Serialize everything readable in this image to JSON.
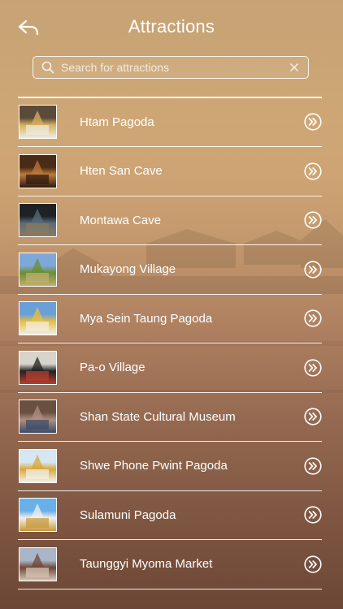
{
  "header": {
    "back_icon": "back-arrow-icon",
    "title": "Attractions"
  },
  "search": {
    "placeholder": "Search for attractions",
    "value": "",
    "icon": "search-icon",
    "clear_icon": "clear-icon"
  },
  "attractions": [
    {
      "name": "Htam Pagoda",
      "thumb_colors": [
        "#5a4a3a",
        "#d7b060",
        "#f0ece0"
      ]
    },
    {
      "name": "Hten San Cave",
      "thumb_colors": [
        "#4a2b15",
        "#c07a3a",
        "#2a1a10"
      ]
    },
    {
      "name": "Montawa Cave",
      "thumb_colors": [
        "#1e2226",
        "#5c6c78",
        "#8c7a60"
      ]
    },
    {
      "name": "Mukayong Village",
      "thumb_colors": [
        "#7ea8d8",
        "#6a8f30",
        "#c0b070"
      ]
    },
    {
      "name": "Mya Sein Taung Pagoda",
      "thumb_colors": [
        "#6aa0d8",
        "#e8c040",
        "#f2efe6"
      ]
    },
    {
      "name": "Pa-o Village",
      "thumb_colors": [
        "#d8d4cc",
        "#222222",
        "#b84030"
      ]
    },
    {
      "name": "Shan State Cultural Museum",
      "thumb_colors": [
        "#6a5040",
        "#b09080",
        "#3a4a68"
      ]
    },
    {
      "name": "Shwe Phone Pwint Pagoda",
      "thumb_colors": [
        "#d6e6f2",
        "#d8a838",
        "#f4f2ec"
      ]
    },
    {
      "name": "Sulamuni Pagoda",
      "thumb_colors": [
        "#6ab0e8",
        "#f0f0f0",
        "#c89838"
      ]
    },
    {
      "name": "Taunggyi Myoma Market",
      "thumb_colors": [
        "#a8b6c8",
        "#704838",
        "#d8c8b8"
      ]
    }
  ],
  "row_action_icon": "double-chevron-right-icon",
  "colors": {
    "text": "#ffffff",
    "background_top": "#d7b07f",
    "background_bottom": "#7b503d"
  }
}
